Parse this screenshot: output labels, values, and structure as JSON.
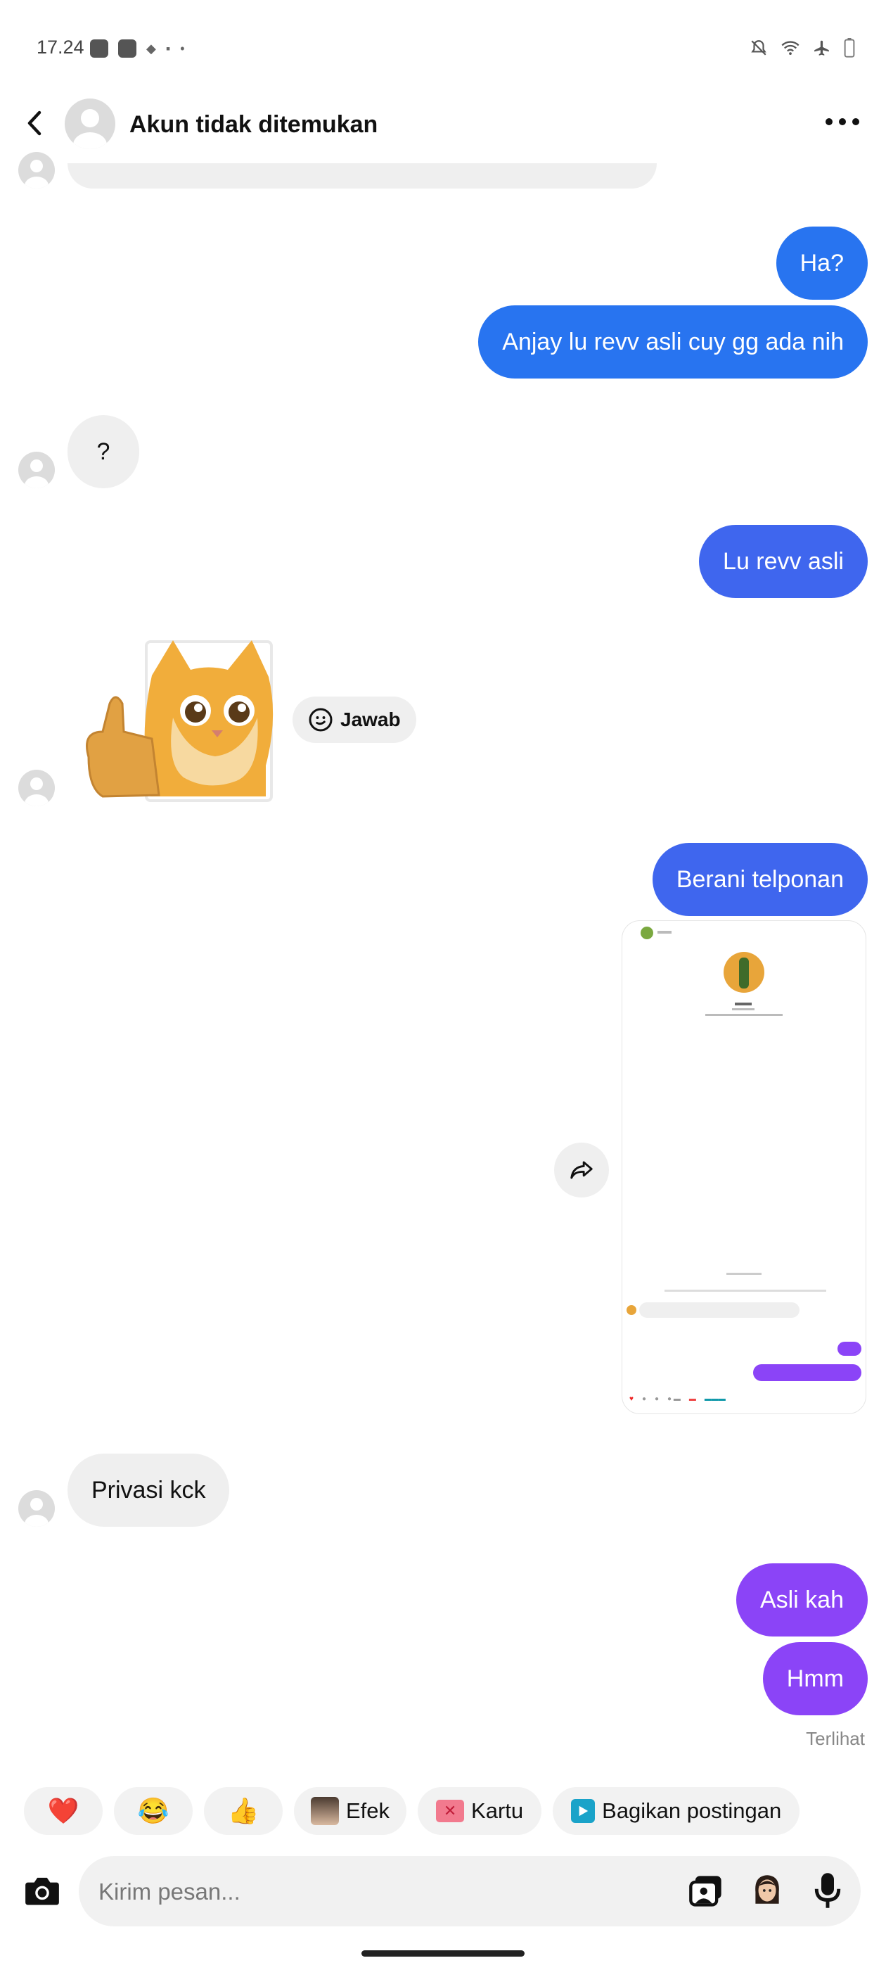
{
  "status": {
    "time": "17.24"
  },
  "header": {
    "title": "Akun tidak ditemukan"
  },
  "messages": {
    "m1": "Ha?",
    "m2": "Anjay lu revv asli cuy gg ada nih",
    "m3": "?",
    "m4": "Lu revv asli",
    "reply_label": "Jawab",
    "m5": "Berani telponan",
    "m6": "Privasi kck",
    "m7": "Asli kah",
    "m8": "Hmm",
    "seen": "Terlihat"
  },
  "quick_actions": {
    "heart": "❤️",
    "laugh": "😂",
    "thumbs": "👍",
    "effects": "Efek",
    "cards": "Kartu",
    "share_post": "Bagikan postingan"
  },
  "composer": {
    "placeholder": "Kirim pesan..."
  },
  "colors": {
    "sent_blue": "#2874f0",
    "sent_purple": "#8b44f7",
    "received": "#efefef"
  }
}
